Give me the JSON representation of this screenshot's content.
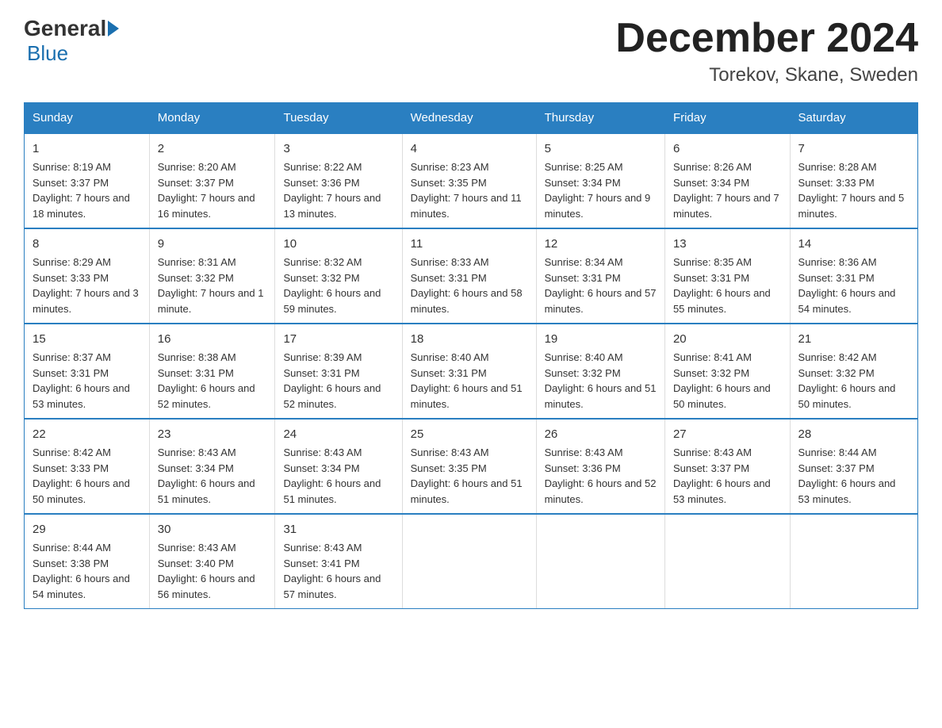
{
  "logo": {
    "general": "General",
    "blue": "Blue"
  },
  "title": "December 2024",
  "subtitle": "Torekov, Skane, Sweden",
  "days_of_week": [
    "Sunday",
    "Monday",
    "Tuesday",
    "Wednesday",
    "Thursday",
    "Friday",
    "Saturday"
  ],
  "weeks": [
    [
      {
        "day": "1",
        "sunrise": "8:19 AM",
        "sunset": "3:37 PM",
        "daylight": "7 hours and 18 minutes."
      },
      {
        "day": "2",
        "sunrise": "8:20 AM",
        "sunset": "3:37 PM",
        "daylight": "7 hours and 16 minutes."
      },
      {
        "day": "3",
        "sunrise": "8:22 AM",
        "sunset": "3:36 PM",
        "daylight": "7 hours and 13 minutes."
      },
      {
        "day": "4",
        "sunrise": "8:23 AM",
        "sunset": "3:35 PM",
        "daylight": "7 hours and 11 minutes."
      },
      {
        "day": "5",
        "sunrise": "8:25 AM",
        "sunset": "3:34 PM",
        "daylight": "7 hours and 9 minutes."
      },
      {
        "day": "6",
        "sunrise": "8:26 AM",
        "sunset": "3:34 PM",
        "daylight": "7 hours and 7 minutes."
      },
      {
        "day": "7",
        "sunrise": "8:28 AM",
        "sunset": "3:33 PM",
        "daylight": "7 hours and 5 minutes."
      }
    ],
    [
      {
        "day": "8",
        "sunrise": "8:29 AM",
        "sunset": "3:33 PM",
        "daylight": "7 hours and 3 minutes."
      },
      {
        "day": "9",
        "sunrise": "8:31 AM",
        "sunset": "3:32 PM",
        "daylight": "7 hours and 1 minute."
      },
      {
        "day": "10",
        "sunrise": "8:32 AM",
        "sunset": "3:32 PM",
        "daylight": "6 hours and 59 minutes."
      },
      {
        "day": "11",
        "sunrise": "8:33 AM",
        "sunset": "3:31 PM",
        "daylight": "6 hours and 58 minutes."
      },
      {
        "day": "12",
        "sunrise": "8:34 AM",
        "sunset": "3:31 PM",
        "daylight": "6 hours and 57 minutes."
      },
      {
        "day": "13",
        "sunrise": "8:35 AM",
        "sunset": "3:31 PM",
        "daylight": "6 hours and 55 minutes."
      },
      {
        "day": "14",
        "sunrise": "8:36 AM",
        "sunset": "3:31 PM",
        "daylight": "6 hours and 54 minutes."
      }
    ],
    [
      {
        "day": "15",
        "sunrise": "8:37 AM",
        "sunset": "3:31 PM",
        "daylight": "6 hours and 53 minutes."
      },
      {
        "day": "16",
        "sunrise": "8:38 AM",
        "sunset": "3:31 PM",
        "daylight": "6 hours and 52 minutes."
      },
      {
        "day": "17",
        "sunrise": "8:39 AM",
        "sunset": "3:31 PM",
        "daylight": "6 hours and 52 minutes."
      },
      {
        "day": "18",
        "sunrise": "8:40 AM",
        "sunset": "3:31 PM",
        "daylight": "6 hours and 51 minutes."
      },
      {
        "day": "19",
        "sunrise": "8:40 AM",
        "sunset": "3:32 PM",
        "daylight": "6 hours and 51 minutes."
      },
      {
        "day": "20",
        "sunrise": "8:41 AM",
        "sunset": "3:32 PM",
        "daylight": "6 hours and 50 minutes."
      },
      {
        "day": "21",
        "sunrise": "8:42 AM",
        "sunset": "3:32 PM",
        "daylight": "6 hours and 50 minutes."
      }
    ],
    [
      {
        "day": "22",
        "sunrise": "8:42 AM",
        "sunset": "3:33 PM",
        "daylight": "6 hours and 50 minutes."
      },
      {
        "day": "23",
        "sunrise": "8:43 AM",
        "sunset": "3:34 PM",
        "daylight": "6 hours and 51 minutes."
      },
      {
        "day": "24",
        "sunrise": "8:43 AM",
        "sunset": "3:34 PM",
        "daylight": "6 hours and 51 minutes."
      },
      {
        "day": "25",
        "sunrise": "8:43 AM",
        "sunset": "3:35 PM",
        "daylight": "6 hours and 51 minutes."
      },
      {
        "day": "26",
        "sunrise": "8:43 AM",
        "sunset": "3:36 PM",
        "daylight": "6 hours and 52 minutes."
      },
      {
        "day": "27",
        "sunrise": "8:43 AM",
        "sunset": "3:37 PM",
        "daylight": "6 hours and 53 minutes."
      },
      {
        "day": "28",
        "sunrise": "8:44 AM",
        "sunset": "3:37 PM",
        "daylight": "6 hours and 53 minutes."
      }
    ],
    [
      {
        "day": "29",
        "sunrise": "8:44 AM",
        "sunset": "3:38 PM",
        "daylight": "6 hours and 54 minutes."
      },
      {
        "day": "30",
        "sunrise": "8:43 AM",
        "sunset": "3:40 PM",
        "daylight": "6 hours and 56 minutes."
      },
      {
        "day": "31",
        "sunrise": "8:43 AM",
        "sunset": "3:41 PM",
        "daylight": "6 hours and 57 minutes."
      },
      {
        "day": "",
        "sunrise": "",
        "sunset": "",
        "daylight": ""
      },
      {
        "day": "",
        "sunrise": "",
        "sunset": "",
        "daylight": ""
      },
      {
        "day": "",
        "sunrise": "",
        "sunset": "",
        "daylight": ""
      },
      {
        "day": "",
        "sunrise": "",
        "sunset": "",
        "daylight": ""
      }
    ]
  ]
}
